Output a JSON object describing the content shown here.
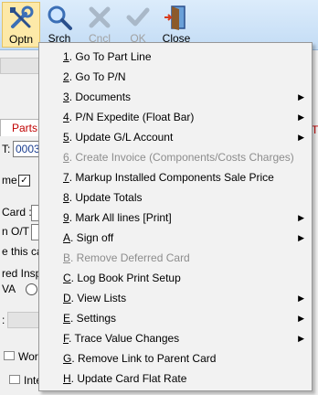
{
  "toolbar": {
    "buttons": [
      {
        "label": "Optn",
        "icon": "wrench-screwdriver-icon",
        "active": true,
        "disabled": false
      },
      {
        "label": "Srch",
        "icon": "magnifier-icon",
        "active": false,
        "disabled": false
      },
      {
        "label": "Cncl",
        "icon": "cancel-x-icon",
        "active": false,
        "disabled": true
      },
      {
        "label": "OK",
        "icon": "checkmark-icon",
        "active": false,
        "disabled": true
      },
      {
        "label": "Close",
        "icon": "door-exit-icon",
        "active": false,
        "disabled": false
      }
    ]
  },
  "background": {
    "tab_parts": "Parts",
    "field_t_label": "T:",
    "field_t_value": "0003",
    "me_label": "me :",
    "card_label": "Card :",
    "ot_label": "n O/T :",
    "this_ca_label": "e this ca",
    "red_inspe_label": "red Inspe",
    "va_label": "VA",
    "colon_label": ":",
    "work_label": "Work",
    "inte_label": "Inte",
    "right_t": "T"
  },
  "menu": {
    "items": [
      {
        "key": "1",
        "text": ". Go To Part Line",
        "submenu": false,
        "disabled": false
      },
      {
        "key": "2",
        "text": ". Go To P/N",
        "submenu": false,
        "disabled": false
      },
      {
        "key": "3",
        "text": ". Documents",
        "submenu": true,
        "disabled": false
      },
      {
        "key": "4",
        "text": ". P/N Expedite (Float Bar)",
        "submenu": true,
        "disabled": false
      },
      {
        "key": "5",
        "text": ". Update G/L Account",
        "submenu": true,
        "disabled": false
      },
      {
        "key": "6",
        "text": ". Create Invoice (Components/Costs Charges)",
        "submenu": false,
        "disabled": true
      },
      {
        "key": "7",
        "text": ". Markup Installed Components Sale Price",
        "submenu": false,
        "disabled": false
      },
      {
        "key": "8",
        "text": ". Update Totals",
        "submenu": false,
        "disabled": false
      },
      {
        "key": "9",
        "text": ". Mark All lines [Print]",
        "submenu": true,
        "disabled": false
      },
      {
        "key": "A",
        "text": ". Sign off",
        "submenu": true,
        "disabled": false
      },
      {
        "key": "B",
        "text": ". Remove Deferred Card",
        "submenu": false,
        "disabled": true
      },
      {
        "key": "C",
        "text": ". Log Book Print Setup",
        "submenu": false,
        "disabled": false
      },
      {
        "key": "D",
        "text": ". View Lists",
        "submenu": true,
        "disabled": false
      },
      {
        "key": "E",
        "text": ". Settings",
        "submenu": true,
        "disabled": false
      },
      {
        "key": "F",
        "text": ". Trace Value Changes",
        "submenu": true,
        "disabled": false
      },
      {
        "key": "G",
        "text": ". Remove Link to Parent Card",
        "submenu": false,
        "disabled": false
      },
      {
        "key": "H",
        "text": ". Update Card Flat Rate",
        "submenu": false,
        "disabled": false
      }
    ],
    "submenu_arrow": "▶"
  }
}
